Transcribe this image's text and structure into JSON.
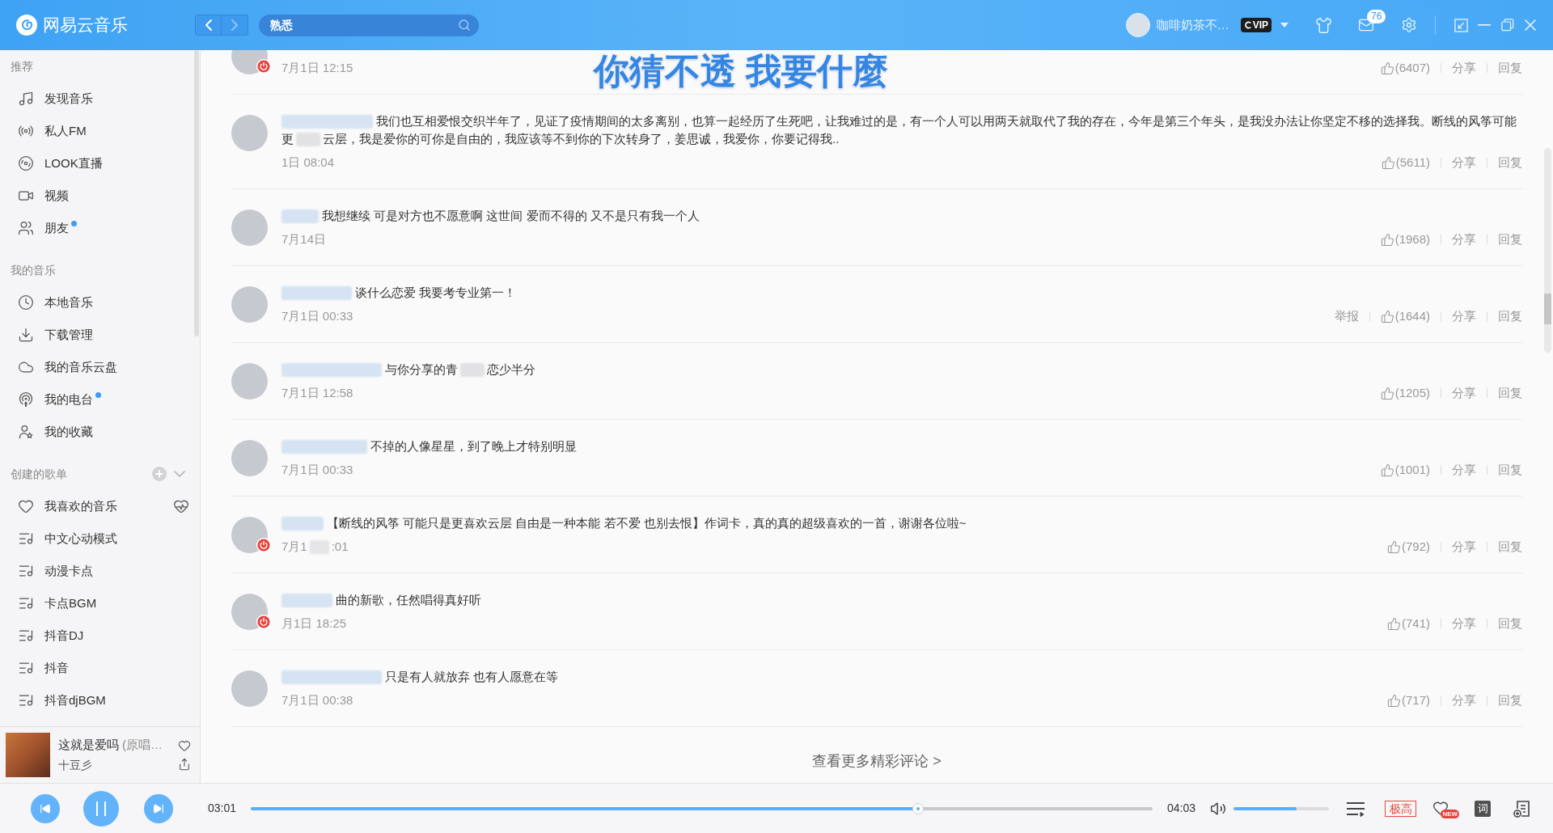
{
  "window": {
    "app_name": "网易云音乐"
  },
  "top_bar": {
    "search": {
      "value": "熟悉"
    },
    "user": {
      "name": "咖啡奶茶不…",
      "vip": "VIP"
    },
    "mail_count": "76"
  },
  "sidebar": {
    "sections": [
      {
        "title": "推荐",
        "kind": "menu",
        "items": [
          {
            "label": "发现音乐",
            "new_dot": false
          },
          {
            "label": "私人FM",
            "new_dot": false
          },
          {
            "label": "LOOK直播",
            "new_dot": false
          },
          {
            "label": "视频",
            "new_dot": false
          },
          {
            "label": "朋友",
            "new_dot": true
          }
        ]
      },
      {
        "title": "我的音乐",
        "kind": "menu",
        "items": [
          {
            "label": "本地音乐",
            "new_dot": false
          },
          {
            "label": "下载管理",
            "new_dot": false
          },
          {
            "label": "我的音乐云盘",
            "new_dot": false
          },
          {
            "label": "我的电台",
            "new_dot": true
          },
          {
            "label": "我的收藏",
            "new_dot": false
          }
        ]
      },
      {
        "title": "创建的歌单",
        "kind": "playlists",
        "items": [
          {
            "label": "我喜欢的音乐",
            "kind": "liked"
          },
          {
            "label": "中文心动模式",
            "kind": "playlist"
          },
          {
            "label": "动漫卡点",
            "kind": "playlist"
          },
          {
            "label": "卡点BGM",
            "kind": "playlist"
          },
          {
            "label": "抖音DJ",
            "kind": "playlist"
          },
          {
            "label": "抖音",
            "kind": "playlist"
          },
          {
            "label": "抖音djBGM",
            "kind": "playlist"
          }
        ]
      }
    ],
    "now_playing": {
      "title": "这就是爱吗",
      "subtitle": "(原唱…",
      "artist": "十豆彡"
    }
  },
  "desktop_lyrics": "你猜不透 我要什麼",
  "comments": [
    {
      "badge": true,
      "name_hidden": false,
      "time": [
        "7月1日 12:15"
      ],
      "likes": "(6407)",
      "share": "分享",
      "reply": "回复"
    },
    {
      "badge": false,
      "name_hidden": true,
      "lines": [
        [
          "我们也互相爱恨交织半年了，见证了疫情期间的太多离别，也算一起经历了生死吧，让我难过的是，有一个人可以用两天就取代了我的存在，今年是第三个年头，是我没办法让你坚定不移的选择我。断线的风筝可能"
        ],
        [
          "更",
          "云层，我是爱你的可你是自由的，我应该等不到你的下次转身了，姜思诚，我爱你，你要记得我.."
        ]
      ],
      "time": [
        "1日 08:04"
      ],
      "likes": "(5611)",
      "share": "分享",
      "reply": "回复"
    },
    {
      "badge": false,
      "name_hidden": true,
      "lines": [
        [
          "我想继续 可是对方也不愿意啊 这世间 爱而不得的 又不是只有我一个人"
        ]
      ],
      "time": [
        "7月14日"
      ],
      "likes": "(1968)",
      "share": "分享",
      "reply": "回复"
    },
    {
      "badge": false,
      "name_hidden": true,
      "lines": [
        [
          "谈什么恋爱 我要考专业第一！"
        ]
      ],
      "time": [
        "7月1日 00:33"
      ],
      "report": "举报",
      "likes": "(1644)",
      "share": "分享",
      "reply": "回复"
    },
    {
      "badge": false,
      "name_hidden": true,
      "lines": [
        [
          "与你分享的青",
          "恋少半分"
        ]
      ],
      "time": [
        "7月1日 12:58"
      ],
      "likes": "(1205)",
      "share": "分享",
      "reply": "回复"
    },
    {
      "badge": false,
      "name_hidden": true,
      "lines": [
        [
          "不掉的人像星星，到了晚上才特别明显"
        ]
      ],
      "time": [
        "7月1日 00:33"
      ],
      "likes": "(1001)",
      "share": "分享",
      "reply": "回复"
    },
    {
      "badge": true,
      "name_hidden": true,
      "lines": [
        [
          "【断线的风筝 可能只是更喜欢云层 自由是一种本能 若不爱 也别去恨】作词卡，真的真的超级喜欢的一首，谢谢各位啦~"
        ]
      ],
      "time": [
        "7月1",
        ":01"
      ],
      "likes": "(792)",
      "share": "分享",
      "reply": "回复"
    },
    {
      "badge": true,
      "name_hidden": true,
      "lines": [
        [
          "曲的新歌，任然唱得真好听"
        ]
      ],
      "time": [
        "月1日 18:25"
      ],
      "likes": "(741)",
      "share": "分享",
      "reply": "回复"
    },
    {
      "badge": false,
      "name_hidden": true,
      "lines": [
        [
          "只是有人就放弃 也有人愿意在等"
        ]
      ],
      "time": [
        "7月1日 00:38"
      ],
      "likes": "(717)",
      "share": "分享",
      "reply": "回复"
    }
  ],
  "more_link": "查看更多精彩评论 >",
  "player": {
    "playing": true,
    "elapsed": "03:01",
    "progress": {
      "level": 0.74
    },
    "total": "04:03",
    "volume": {
      "level": 0.66
    },
    "quality": "极高",
    "new_tag": "NEW",
    "lyrics_key": "词"
  }
}
